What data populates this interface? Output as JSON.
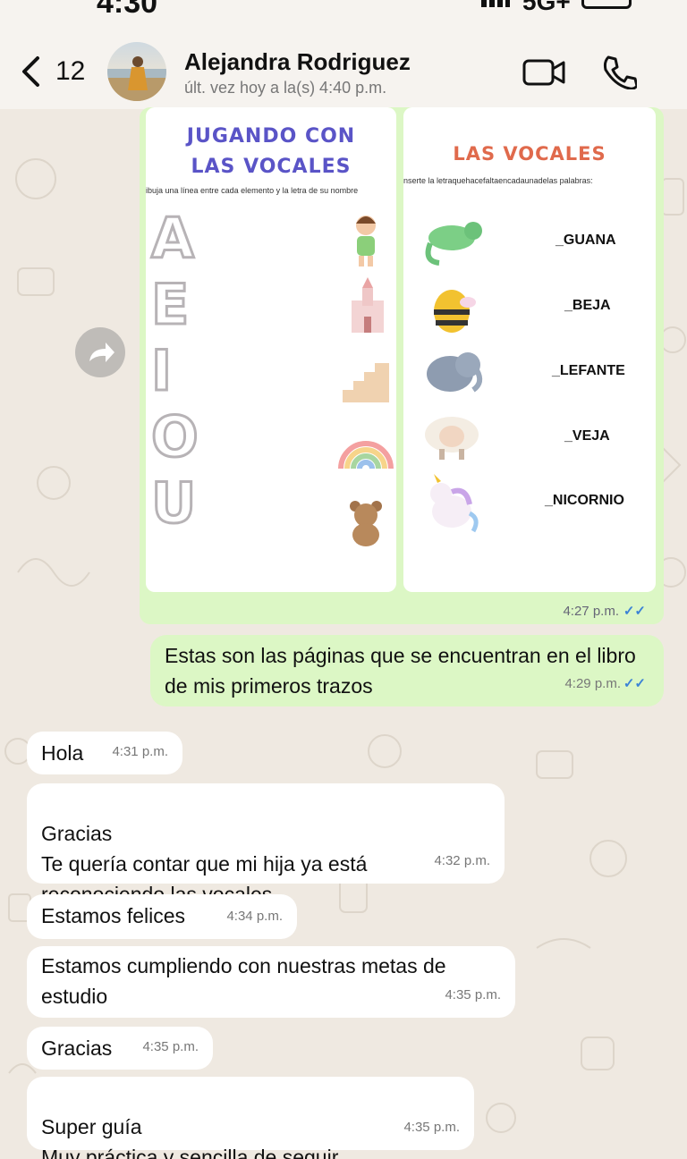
{
  "status": {
    "time": "4:30",
    "network": "5G+"
  },
  "header": {
    "back_count": "12",
    "contact_name": "Alejandra Rodriguez",
    "last_seen": "últ. vez hoy a la(s) 4:40 p.m."
  },
  "image_message": {
    "page1": {
      "title": "JUGANDO CON LAS VOCALES",
      "instruction": "ibuja una línea entre cada elemento y la letra de su nombre",
      "vowels": [
        "A",
        "E",
        "I",
        "O",
        "U"
      ]
    },
    "page2": {
      "title": "LAS VOCALES",
      "instruction": "nserte la letraquehacefaltaencadaunadelas palabras:",
      "words": [
        "_GUANA",
        "_BEJA",
        "_LEFANTE",
        "_VEJA",
        "_NICORNIO"
      ]
    },
    "time": "4:27 p.m.",
    "ticks": "✓✓"
  },
  "messages": [
    {
      "dir": "out",
      "text": "Estas son las páginas que se encuentran en el libro de mis primeros trazos",
      "time": "4:29 p.m.",
      "ticks": "✓✓"
    },
    {
      "dir": "in",
      "text": "Hola",
      "time": "4:31 p.m."
    },
    {
      "dir": "in",
      "text": "Gracias\nTe quería contar que mi hija ya está reconociendo las vocales",
      "time": "4:32 p.m."
    },
    {
      "dir": "in",
      "text": "Estamos felices",
      "time": "4:34 p.m."
    },
    {
      "dir": "in",
      "text": "Estamos cumpliendo con nuestras metas de estudio",
      "time": "4:35 p.m."
    },
    {
      "dir": "in",
      "text": "Gracias",
      "time": "4:35 p.m."
    },
    {
      "dir": "in",
      "text": "Super guía\nMuy práctica y sencilla de seguir",
      "time": "4:35 p.m."
    }
  ],
  "colors": {
    "outgoing_bubble": "#dcf7c5",
    "incoming_bubble": "#ffffff",
    "read_ticks": "#3b82d6",
    "wallpaper": "#efe9e1"
  },
  "icons": [
    "back-chevron-icon",
    "video-call-icon",
    "phone-call-icon",
    "forward-icon",
    "read-ticks-icon"
  ]
}
